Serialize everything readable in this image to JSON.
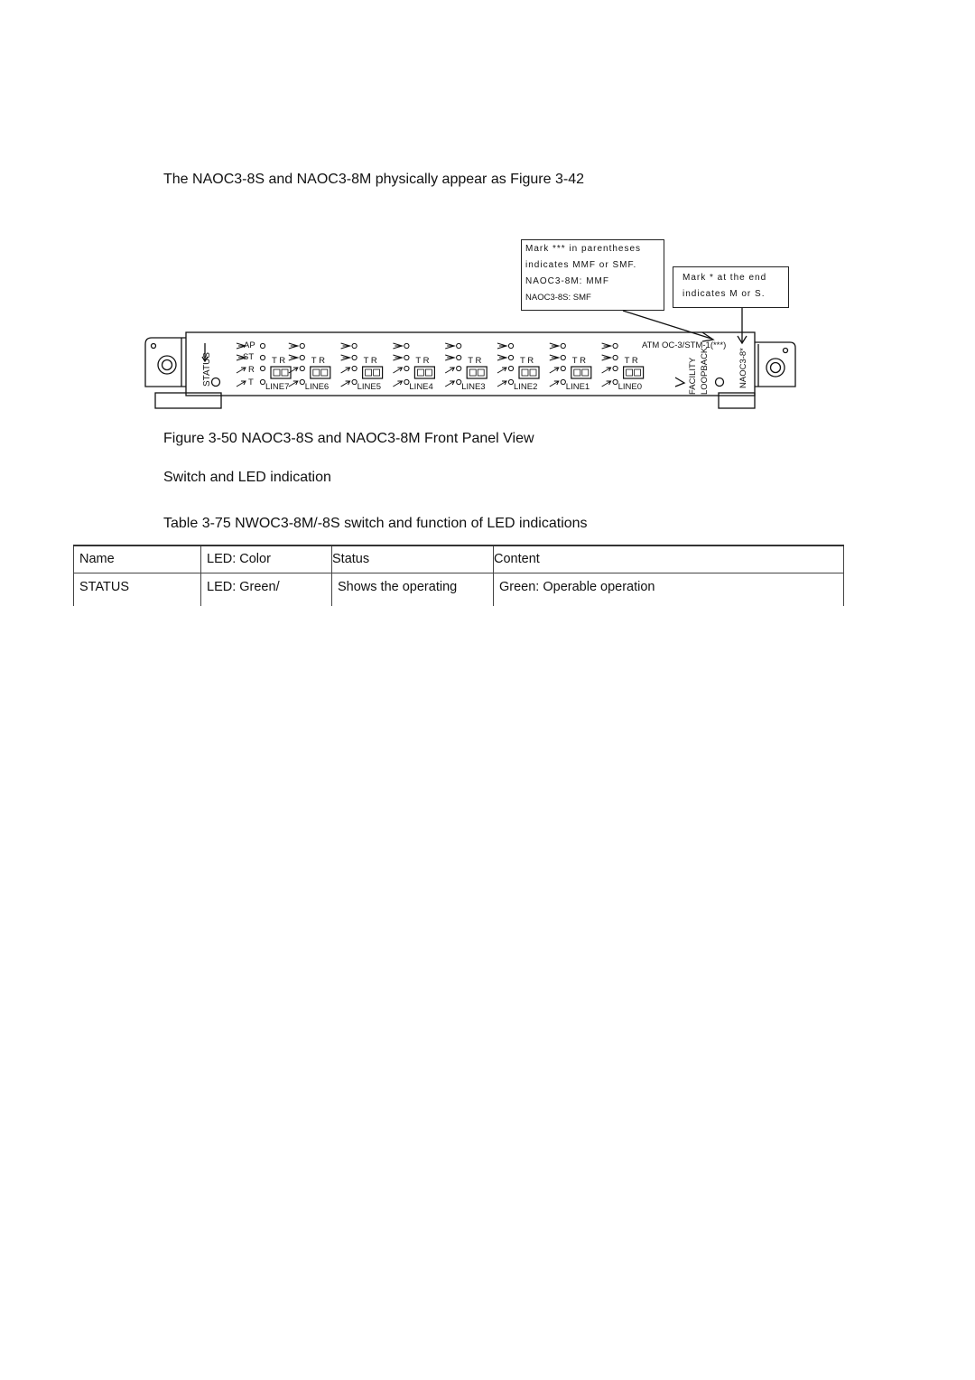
{
  "intro": "The NAOC3-8S and NAOC3-8M physically appear as Figure 3-42",
  "callouts": {
    "left": [
      "Mark *** in parentheses",
      "indicates MMF or SMF.",
      "NAOC3-8M: MMF",
      "NAOC3-8S: SMF"
    ],
    "right": [
      "Mark * at the end",
      "indicates M or S."
    ]
  },
  "panel": {
    "status_label": "STATUS",
    "led_labels": [
      "AP",
      "ST",
      "R",
      "T"
    ],
    "tr_label": "T R",
    "lines": [
      "LINE7",
      "LINE6",
      "LINE5",
      "LINE4",
      "LINE3",
      "LINE2",
      "LINE1",
      "LINE0"
    ],
    "atm_label": "ATM OC-3/STM-1(***)",
    "facility_label": "FACILITY",
    "loopback_label": "LOOPBACK",
    "model_label": "NAOC3-8*"
  },
  "figure_caption": "Figure 3-50 NAOC3-8S and NAOC3-8M Front Panel View",
  "section_heading": "Switch and LED indication",
  "table_caption": "Table 3-75  NWOC3-8M/-8S switch and function of LED indications",
  "table": {
    "headers": [
      "Name",
      "LED: Color",
      "Status",
      "Content"
    ],
    "rows": [
      [
        "STATUS",
        "LED: Green/",
        "Shows the operating",
        "Green: Operable operation"
      ]
    ]
  }
}
